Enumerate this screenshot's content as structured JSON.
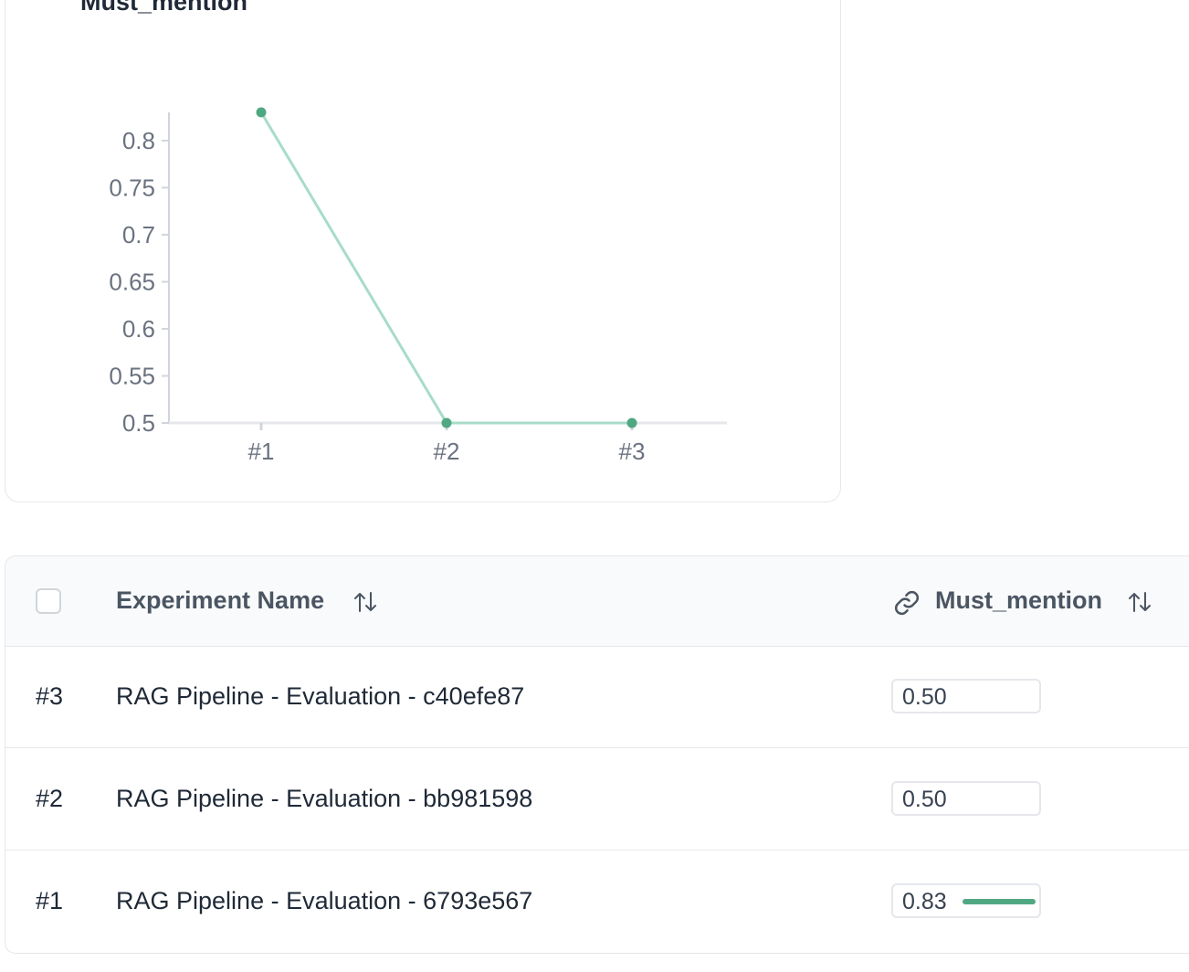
{
  "chart_data": {
    "type": "line",
    "title": "Must_mention",
    "categories": [
      "#1",
      "#2",
      "#3"
    ],
    "values": [
      0.83,
      0.5,
      0.5
    ],
    "yticks": [
      "0.5",
      "0.55",
      "0.6",
      "0.65",
      "0.7",
      "0.75",
      "0.8"
    ],
    "ylim": [
      0.5,
      0.83
    ],
    "line_color": "#a8dcc8",
    "point_color": "#4fa882",
    "grid": false
  },
  "table": {
    "columns": {
      "name": "Experiment Name",
      "metric": "Must_mention"
    },
    "rows": [
      {
        "id": "#3",
        "name": "RAG Pipeline - Evaluation - c40efe87",
        "score": "0.50",
        "score_value": 0.5
      },
      {
        "id": "#2",
        "name": "RAG Pipeline - Evaluation - bb981598",
        "score": "0.50",
        "score_value": 0.5
      },
      {
        "id": "#1",
        "name": "RAG Pipeline - Evaluation - 6793e567",
        "score": "0.83",
        "score_value": 0.83
      }
    ],
    "bar_color": "#4fa882"
  }
}
